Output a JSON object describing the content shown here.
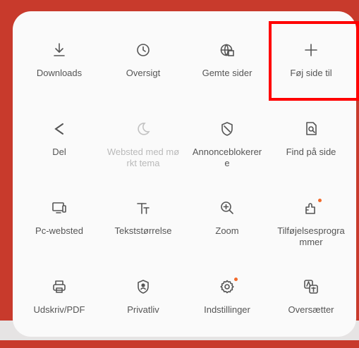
{
  "menu": {
    "items": [
      {
        "label": "Downloads",
        "icon": "download-icon"
      },
      {
        "label": "Oversigt",
        "icon": "clock-icon"
      },
      {
        "label": "Gemte sider",
        "icon": "saved-pages-globe-icon"
      },
      {
        "label": "Føj side til",
        "icon": "plus-icon"
      },
      {
        "label": "Del",
        "icon": "share-icon"
      },
      {
        "label": "Websted med mørkt tema",
        "icon": "moon-icon"
      },
      {
        "label": "Annonceblokerere",
        "icon": "shield-block-icon"
      },
      {
        "label": "Find på side",
        "icon": "find-on-page-icon"
      },
      {
        "label": "Pc-websted",
        "icon": "desktop-site-icon"
      },
      {
        "label": "Tekststørrelse",
        "icon": "text-size-icon"
      },
      {
        "label": "Zoom",
        "icon": "zoom-in-icon"
      },
      {
        "label": "Tilføjelsesprogrammer",
        "icon": "add-ons-icon"
      },
      {
        "label": "Udskriv/PDF",
        "icon": "print-icon"
      },
      {
        "label": "Privatliv",
        "icon": "privacy-shield-icon"
      },
      {
        "label": "Indstillinger",
        "icon": "gear-icon"
      },
      {
        "label": "Oversætter",
        "icon": "translate-icon"
      }
    ]
  },
  "colors": {
    "background": "#c83a2c",
    "panel": "#fafafa",
    "highlight": "#ff0000",
    "badge": "#f26a2b"
  }
}
